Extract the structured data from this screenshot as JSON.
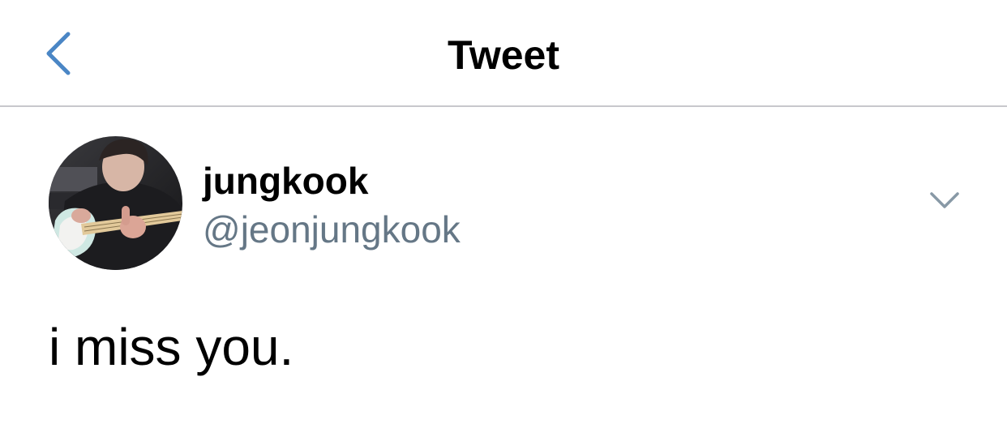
{
  "nav": {
    "title": "Tweet",
    "back_icon": "chevron-left-icon"
  },
  "tweet": {
    "display_name": "jungkook",
    "handle": "@jeonjungkook",
    "text": "i miss you.",
    "more_icon": "chevron-down-icon"
  },
  "colors": {
    "accent": "#4a86c5",
    "handle": "#657786",
    "divider": "#c8c8cc",
    "chevron_down": "#8899a6"
  }
}
